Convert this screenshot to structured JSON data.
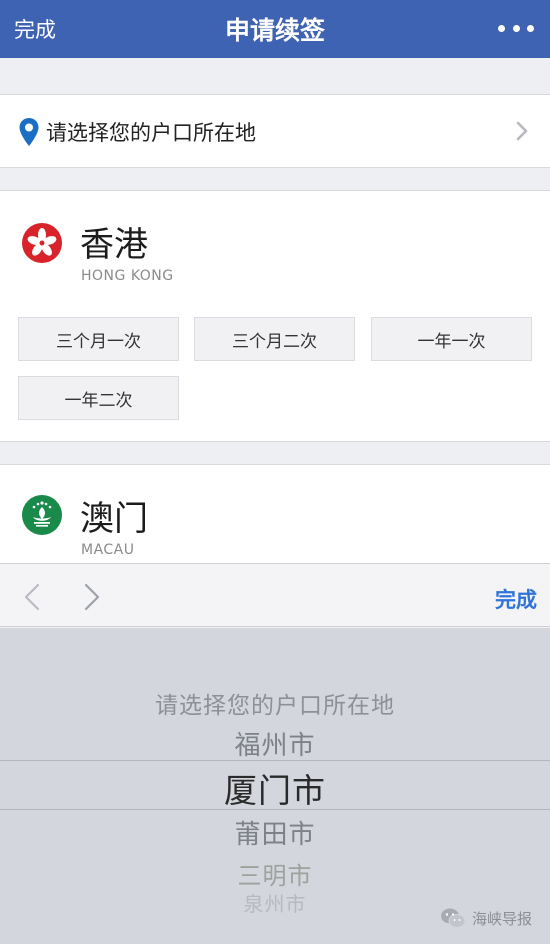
{
  "navbar": {
    "done_label": "完成",
    "title": "申请续签",
    "more_icon": "more-dots-icon"
  },
  "location": {
    "prompt": "请选择您的户口所在地",
    "icon": "location-pin-icon"
  },
  "regions": [
    {
      "name": "香港",
      "name_en": "HONG KONG",
      "flag_icon": "hong-kong-flag-icon",
      "options": [
        "三个月一次",
        "三个月二次",
        "一年一次",
        "一年二次"
      ]
    },
    {
      "name": "澳门",
      "name_en": "MACAU",
      "flag_icon": "macau-flag-icon"
    }
  ],
  "toolbar": {
    "prev_icon": "chevron-left-icon",
    "next_icon": "chevron-right-icon",
    "done_label": "完成"
  },
  "picker": {
    "items": [
      "请选择您的户口所在地",
      "福州市",
      "厦门市",
      "莆田市",
      "三明市",
      "泉州市"
    ],
    "selected": "厦门市"
  },
  "watermark": {
    "text": "海峡导报",
    "icon": "wechat-icon"
  },
  "colors": {
    "navbar": "#3f63b3",
    "accent": "#2f74d6",
    "hk_flag": "#d8232a",
    "mo_flag": "#1a8a4a"
  }
}
